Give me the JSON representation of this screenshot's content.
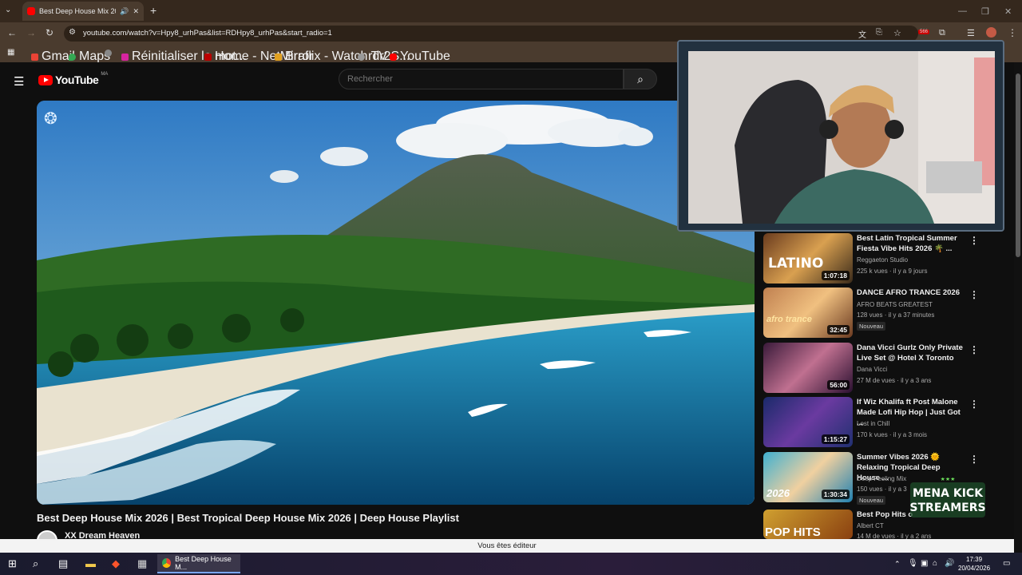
{
  "browser": {
    "tab_title": "Best Deep House Mix 2026",
    "url": "youtube.com/watch?v=Hpy8_urhPas&list=RDHpy8_urhPas&start_radio=1",
    "extension_badge": "566",
    "bookmarks": [
      "Gmail",
      "Maps",
      "Réinitialiser le mot...",
      "Home - NetMirror",
      "Braflix - Watch TV S...",
      "rdr2",
      "YouTube"
    ]
  },
  "youtube": {
    "logo_text": "YouTube",
    "country_code": "MA",
    "search_placeholder": "Rechercher"
  },
  "video": {
    "title": "Best Deep House Mix 2026 | Best Tropical Deep House Mix 2026 | Deep House Playlist",
    "channel": "XX Dream Heaven"
  },
  "recommendations": [
    {
      "title": "Best Latin Tropical Summer Fiesta Vibe Hits 2026 🌴 ...",
      "channel": "Reggaeton Studio",
      "meta": "225 k vues · il y a 9 jours",
      "duration": "1:07:18",
      "badge": "",
      "thumb_text": "LATINO"
    },
    {
      "title": "DANCE AFRO TRANCE 2026",
      "channel": "AFRO BEATS GREATEST",
      "meta": "128 vues · il y a 37 minutes",
      "duration": "32:45",
      "badge": "Nouveau",
      "thumb_text": "afro trance"
    },
    {
      "title": "Dana Vicci Gurlz Only Private Live Set @ Hotel X Toronto",
      "channel": "Dana Vicci",
      "meta": "27 M de vues · il y a 3 ans",
      "duration": "56:00",
      "badge": "",
      "thumb_text": ""
    },
    {
      "title": "If Wiz Khalifa ft Post Malone Made Lofi Hip Hop | Just Got ...",
      "channel": "Lost in Chill",
      "meta": "170 k vues · il y a 3 mois",
      "duration": "1:15:27",
      "badge": "",
      "thumb_text": ""
    },
    {
      "title": "Summer Vibes 2026 🌞 Relaxing Tropical Deep House ...",
      "channel": "Deep Feeling Mix",
      "meta": "150 vues · il y a 3",
      "duration": "1:30:34",
      "badge": "Nouveau",
      "thumb_text": "2026"
    },
    {
      "title": "Best Pop Hits o",
      "channel": "Albert CT",
      "meta": "14 M de vues · il y a 2 ans",
      "duration": "",
      "badge": "",
      "thumb_text": "POP HITS"
    }
  ],
  "overlay": {
    "logo_line1": "MENA KICK",
    "logo_line2": "STREAMERS"
  },
  "notification": "Vous êtes éditeur",
  "taskbar": {
    "app_label": "Best Deep House M...",
    "time": "17:39",
    "date": "20/04/2026"
  }
}
